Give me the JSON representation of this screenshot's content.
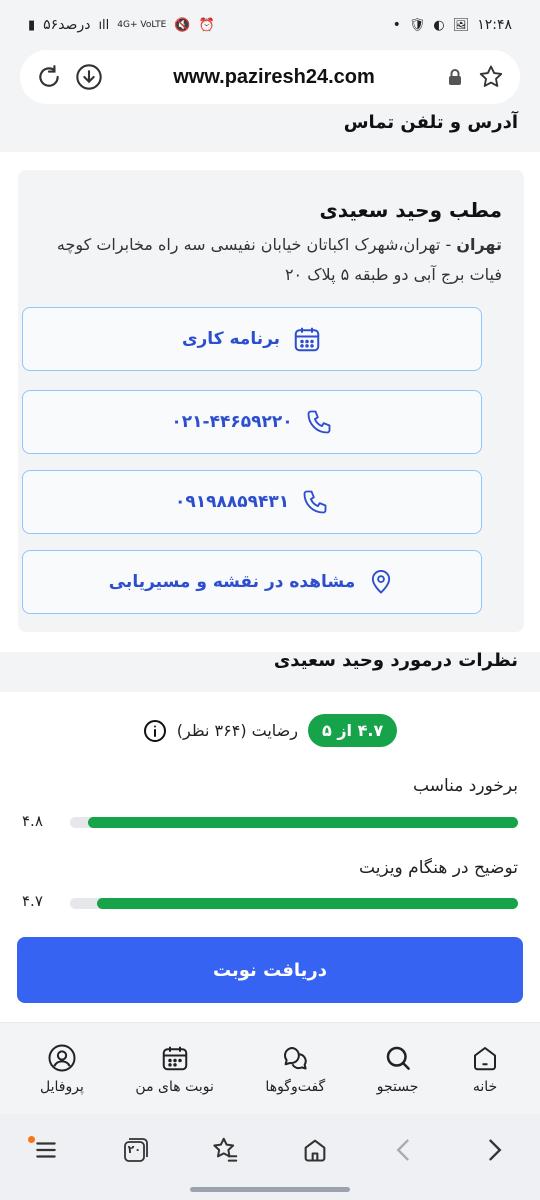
{
  "status": {
    "time": "۱۲:۴۸",
    "battery": "۵۶درصد",
    "network": "4G+ VoLTE"
  },
  "browser": {
    "url": "www.paziresh24.com"
  },
  "address_section": {
    "title": "آدرس و تلفن تماس",
    "clinic_name": "مطب وحید سعیدی",
    "city": "تهران",
    "address": " - تهران،شهرک اکباتان خیابان نفیسی سه راه مخابرات کوچه فیات برج آبی دو طبقه ۵ پلاک ۲۰",
    "schedule_label": "برنامه کاری",
    "phone1": "۰۲۱-۴۴۶۵۹۲۲۰",
    "phone2": "۰۹۱۹۸۸۵۹۴۳۱",
    "map_label": "مشاهده در نقشه و مسیریابی"
  },
  "reviews": {
    "title": "نظرات درمورد وحید سعیدی",
    "badge": "۴.۷ از ۵",
    "satisfaction": "رضایت (۳۶۴ نظر)",
    "metrics": [
      {
        "label": "برخورد مناسب",
        "value": "۴.۸",
        "score": 4.8
      },
      {
        "label": "توضیح در هنگام ویزیت",
        "value": "۴.۷",
        "score": 4.7
      }
    ]
  },
  "cta": {
    "label": "دریافت نوبت"
  },
  "app_nav": [
    {
      "label": "خانه",
      "icon": "home-icon"
    },
    {
      "label": "جستجو",
      "icon": "search-icon"
    },
    {
      "label": "گفت‌وگوها",
      "icon": "chat-icon"
    },
    {
      "label": "نوبت های من",
      "icon": "calendar-icon"
    },
    {
      "label": "پروفایل",
      "icon": "profile-icon"
    }
  ],
  "browser_nav": {
    "tabs_count": "۲۰"
  },
  "colors": {
    "primary": "#3663f2",
    "link": "#2d4fcf",
    "rating_green": "#16a34a",
    "notification_dot": "#f97316"
  }
}
